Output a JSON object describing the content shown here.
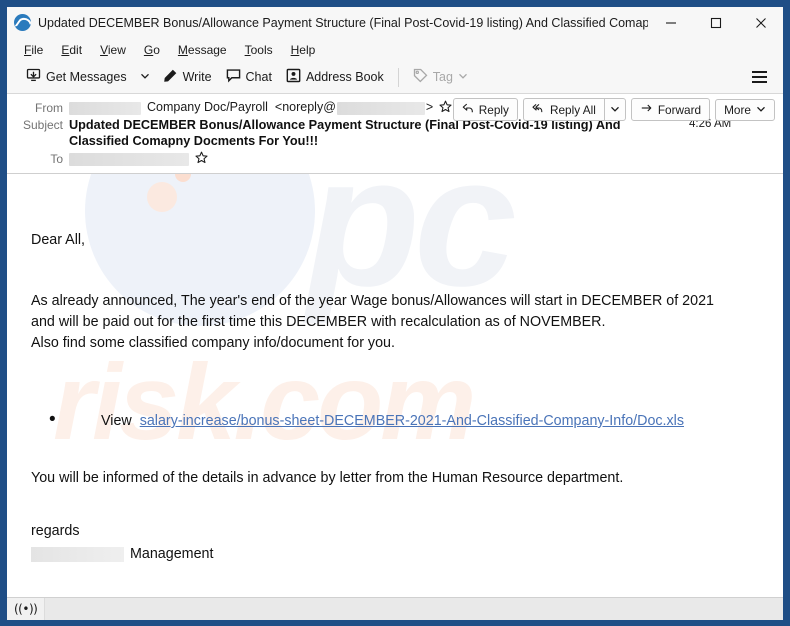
{
  "window": {
    "title": "Updated DECEMBER Bonus/Allowance Payment Structure (Final Post-Covid-19 listing) And Classified Comapny Do...",
    "app_icon": "thunderbird-icon",
    "minimize_label": "—",
    "maximize_label": "☐",
    "close_label": "✕",
    "frame_color": "#1f4e86"
  },
  "menu": {
    "items": [
      {
        "label": "File",
        "accel": "F",
        "rest": "ile"
      },
      {
        "label": "Edit",
        "accel": "E",
        "rest": "dit"
      },
      {
        "label": "View",
        "accel": "V",
        "rest": "iew"
      },
      {
        "label": "Go",
        "accel": "G",
        "rest": "o"
      },
      {
        "label": "Message",
        "accel": "M",
        "rest": "essage"
      },
      {
        "label": "Tools",
        "accel": "T",
        "rest": "ools"
      },
      {
        "label": "Help",
        "accel": "H",
        "rest": "elp"
      }
    ]
  },
  "toolbar": {
    "get_messages_label": "Get Messages",
    "get_messages_icon": "download-inbox-icon",
    "get_messages_dropdown_icon": "chevron-down-icon",
    "write_label": "Write",
    "write_icon": "pencil-icon",
    "chat_label": "Chat",
    "chat_icon": "speech-bubble-icon",
    "address_book_label": "Address Book",
    "address_book_icon": "contact-card-icon",
    "tag_label": "Tag",
    "tag_icon": "tag-icon",
    "tag_dropdown_icon": "chevron-down-icon",
    "tag_disabled": true,
    "app_menu_icon": "hamburger-icon"
  },
  "header": {
    "from_label": "From",
    "from_redacted": true,
    "from_display_name": "Company Doc/Payroll",
    "from_address_prefix": "<noreply@",
    "from_address_suffix": ">",
    "from_star_icon": "star-icon",
    "subject_label": "Subject",
    "subject": "Updated DECEMBER Bonus/Allowance Payment Structure (Final Post-Covid-19 listing) And Classified Comapny Docments For You!!!",
    "time": "4:26 AM",
    "to_label": "To",
    "to_redacted": true,
    "to_star_icon": "star-icon"
  },
  "actions": {
    "reply_label": "Reply",
    "reply_icon": "reply-arrow-icon",
    "reply_all_label": "Reply All",
    "reply_all_icon": "reply-all-arrow-icon",
    "reply_all_dropdown_icon": "chevron-down-icon",
    "forward_label": "Forward",
    "forward_icon": "forward-arrow-icon",
    "more_label": "More",
    "more_dropdown_icon": "chevron-down-icon"
  },
  "body": {
    "greeting": "Dear All,",
    "paragraph_lines": [
      "As already announced, The year's end of the year Wage bonus/Allowances will start in DECEMBER of 2021",
      "and will be paid out for the first time this DECEMBER with recalculation as of NOVEMBER.",
      "Also find some classified company info/document for you."
    ],
    "bullet_prefix": "View",
    "link_text": "salary-increase/bonus-sheet-DECEMBER-2021-And-Classified-Company-Info/Doc.xls",
    "link_color": "#4a74b8",
    "closing_paragraph": "You will be informed of the details in advance by letter from the Human Resource department.",
    "regards": "regards",
    "signature_redacted": true,
    "signature": "Management"
  },
  "watermark": {
    "mark_primary": "pc",
    "mark_secondary": "risk.com",
    "primary_color": "#f1f3f7",
    "secondary_color": "#fdf0e9"
  },
  "status": {
    "offline_icon": "broadcast-offline-icon",
    "offline_glyph": "((•))",
    "text": ""
  }
}
